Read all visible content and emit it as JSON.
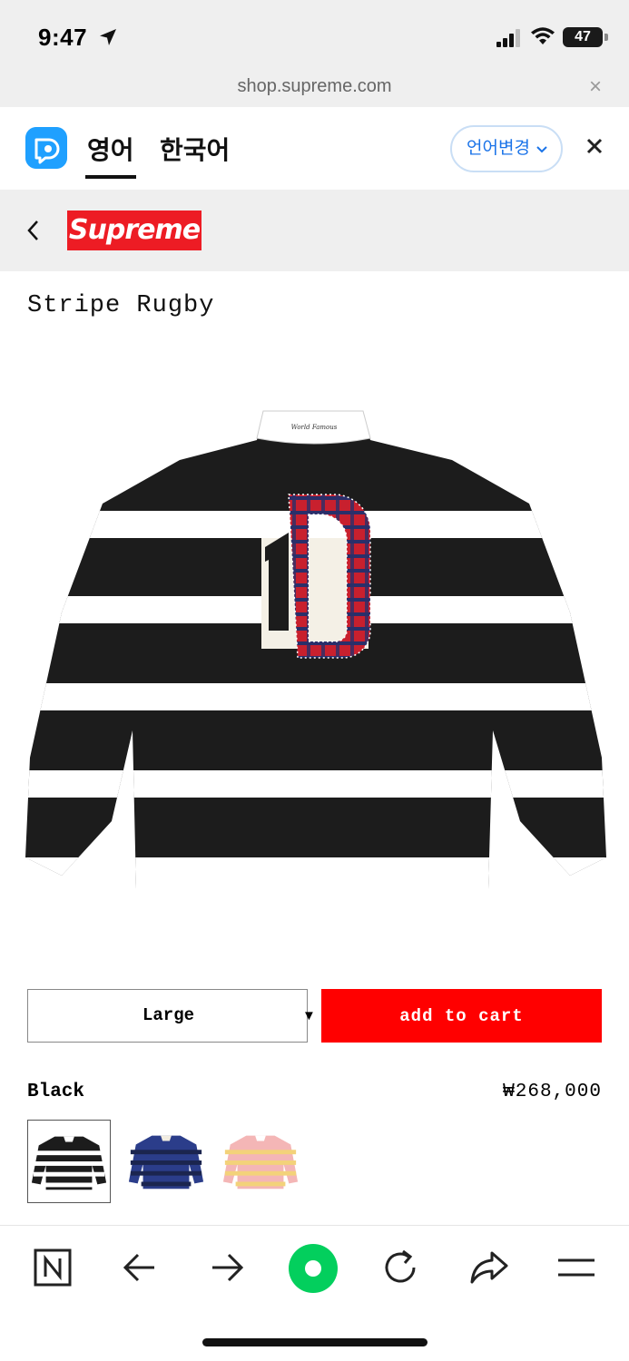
{
  "status_bar": {
    "time": "9:47",
    "battery": "47"
  },
  "browser": {
    "url": "shop.supreme.com"
  },
  "translate_bar": {
    "source_tab": "영어",
    "target_tab": "한국어",
    "change_label": "언어변경",
    "accent": "#1fa0ff"
  },
  "site": {
    "logo_text": "Supreme",
    "logo_color": "#ed1c24"
  },
  "product": {
    "title": "Stripe Rugby",
    "size": "Large",
    "add_to_cart": "add to cart",
    "color": "Black",
    "price": "₩268,000",
    "button_color": "#ff0000",
    "swatches": [
      {
        "name": "Black",
        "colors": [
          "#1c1c1c",
          "#ffffff"
        ]
      },
      {
        "name": "Navy",
        "colors": [
          "#2b3d8a",
          "#1b254f"
        ]
      },
      {
        "name": "Pink",
        "colors": [
          "#f4b6b6",
          "#f3d27a"
        ]
      }
    ]
  },
  "bottom_bar": {
    "icons": [
      "naver-icon",
      "back-arrow-icon",
      "forward-arrow-icon",
      "home-icon",
      "reload-icon",
      "share-icon",
      "menu-icon"
    ]
  }
}
